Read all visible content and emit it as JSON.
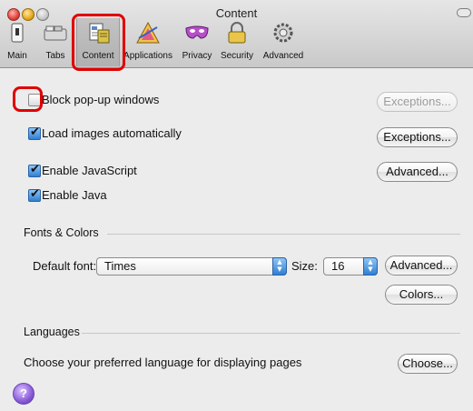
{
  "window": {
    "title": "Content"
  },
  "toolbar": {
    "items": [
      {
        "label": "Main",
        "icon": "main-switch-icon"
      },
      {
        "label": "Tabs",
        "icon": "tabs-icon"
      },
      {
        "label": "Content",
        "icon": "content-icon",
        "selected": true
      },
      {
        "label": "Applications",
        "icon": "applications-icon"
      },
      {
        "label": "Privacy",
        "icon": "privacy-mask-icon"
      },
      {
        "label": "Security",
        "icon": "security-lock-icon"
      },
      {
        "label": "Advanced",
        "icon": "advanced-gear-icon"
      }
    ]
  },
  "content": {
    "block_popups": {
      "label": "Block pop-up windows",
      "checked": false,
      "exceptions_label": "Exceptions...",
      "exceptions_enabled": false
    },
    "load_images": {
      "label": "Load images automatically",
      "checked": true,
      "exceptions_label": "Exceptions..."
    },
    "javascript": {
      "label": "Enable JavaScript",
      "checked": true,
      "advanced_label": "Advanced..."
    },
    "java": {
      "label": "Enable Java",
      "checked": true
    }
  },
  "fonts_colors": {
    "title": "Fonts & Colors",
    "default_font_label": "Default font:",
    "default_font_value": "Times",
    "size_label": "Size:",
    "size_value": "16",
    "advanced_label": "Advanced...",
    "colors_label": "Colors..."
  },
  "languages": {
    "title": "Languages",
    "description": "Choose your preferred language for displaying pages",
    "choose_label": "Choose..."
  },
  "help": {
    "label": "?"
  },
  "colors": {
    "accent": "#2f7fd3",
    "highlight": "#e00000"
  }
}
